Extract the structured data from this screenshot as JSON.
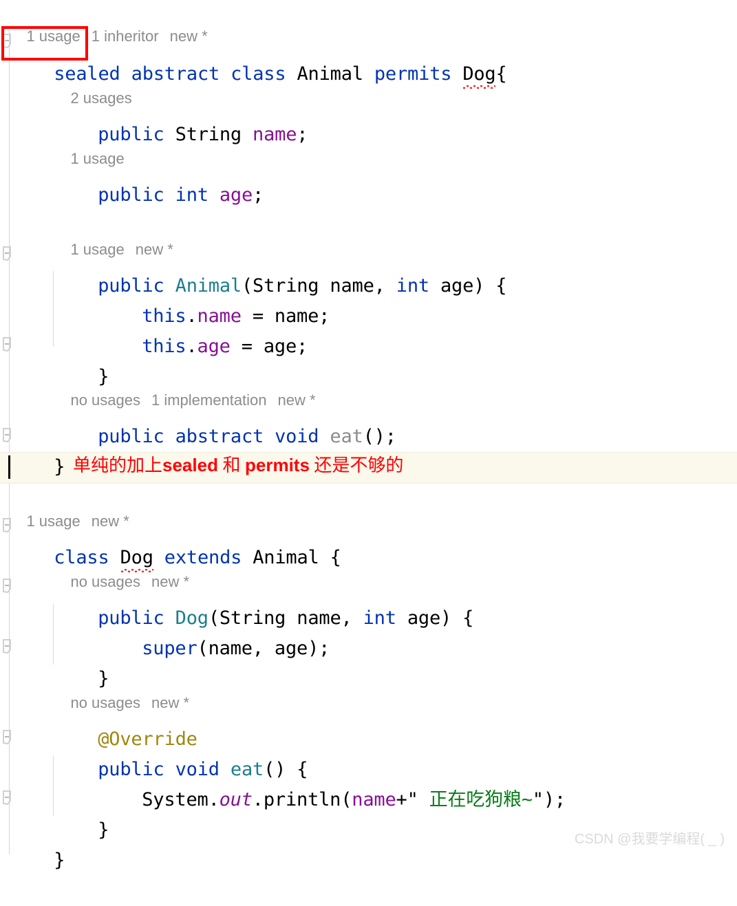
{
  "editor": {
    "background": "#ffffff",
    "caret_line_background": "#fbf8ec",
    "error_squiggle_color": "#e8312a",
    "annotation_color": "#ff0000"
  },
  "hints": {
    "animal_class": {
      "a": "1 usage",
      "b": "1 inheritor",
      "c": "new *"
    },
    "name_field": {
      "a": "2 usages"
    },
    "age_field": {
      "a": "1 usage"
    },
    "animal_ctor": {
      "a": "1 usage",
      "b": "new *"
    },
    "eat_abstract": {
      "a": "no usages",
      "b": "1 implementation",
      "c": "new *"
    },
    "dog_class": {
      "a": "1 usage",
      "b": "new *"
    },
    "dog_ctor": {
      "a": "no usages",
      "b": "new *"
    },
    "dog_eat": {
      "a": "no usages",
      "b": "new *"
    }
  },
  "code": {
    "l1_sealed": "sealed",
    "l1_rest": " abstract class ",
    "l1_animal": "Animal",
    "l1_permits": " permits ",
    "l1_dog": "Dog",
    "l1_brace": "{",
    "l2_public": "public",
    "l2_string": " String ",
    "l2_name": "name",
    "l2_semi": ";",
    "l3_public": "public",
    "l3_int": " int",
    "l3_space": " ",
    "l3_age": "age",
    "l3_semi": ";",
    "l4_public": "public",
    "l4_ctor": " Animal",
    "l4_open": "(",
    "l4_stringty": "String",
    "l4_pname": " name, ",
    "l4_intty": "int",
    "l4_page": " age) {",
    "l5_this": "this",
    "l5_dot": ".",
    "l5_name": "name",
    "l5_assign": " = name;",
    "l6_this": "this",
    "l6_dot": ".",
    "l6_age": "age",
    "l6_assign": " = age;",
    "l7_close": "}",
    "l8_mods": "public abstract void",
    "l8_space": " ",
    "l8_eat": "eat",
    "l8_tail": "();",
    "l9_close": "}",
    "l10_class": "class",
    "l10_space": " ",
    "l10_dog": "Dog",
    "l10_extends": " extends ",
    "l10_animal": "Animal",
    "l10_brace": " {",
    "l11_public": "public",
    "l11_dog": " Dog",
    "l11_open": "(",
    "l11_stringty": "String",
    "l11_pname": " name, ",
    "l11_intty": "int",
    "l11_page": " age) {",
    "l12_super": "super",
    "l12_args": "(name, age);",
    "l13_close": "}",
    "l14_override": "@Override",
    "l15_mods": "public void",
    "l15_space": " ",
    "l15_eat": "eat",
    "l15_tail": "() {",
    "l16_system": "System.",
    "l16_out": "out",
    "l16_println": ".println(",
    "l16_name": "name",
    "l16_plusq": "+\"",
    "l16_str": " 正在吃狗粮~",
    "l16_endq": "\");",
    "l17_close": "}",
    "l18_close": "}"
  },
  "annotation": {
    "box_target": "sealed",
    "note_pre": "单纯的加上",
    "note_bold1": "sealed",
    "note_mid": " 和 ",
    "note_bold2": "permits",
    "note_post": " 还是不够的"
  },
  "watermark": {
    "text": "CSDN @我要学编程( _ )"
  }
}
